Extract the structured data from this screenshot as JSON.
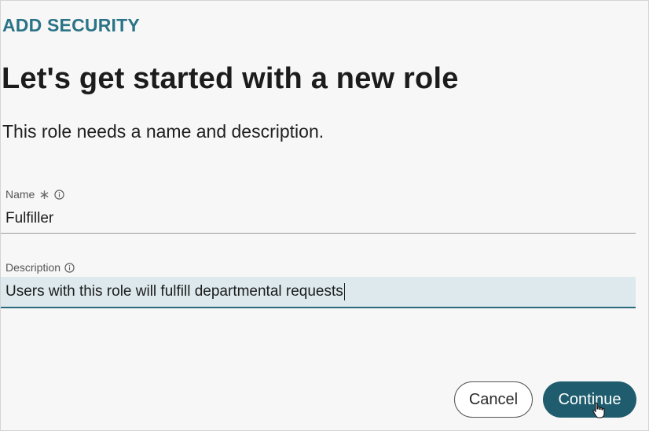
{
  "header": {
    "eyebrow": "ADD SECURITY",
    "title": "Let's get started with a new role",
    "subtitle": "This role needs a name and description."
  },
  "form": {
    "name": {
      "label": "Name",
      "required_icon": "asterisk-icon",
      "info_icon": "info-icon",
      "value": "Fulfiller"
    },
    "description": {
      "label": "Description",
      "info_icon": "info-icon",
      "value": "Users with this role will fulfill departmental requests"
    }
  },
  "actions": {
    "cancel_label": "Cancel",
    "continue_label": "Continue"
  },
  "colors": {
    "accent": "#2b7387",
    "primary_button": "#1f5d6e",
    "focused_field_bg": "#dde9ed"
  }
}
